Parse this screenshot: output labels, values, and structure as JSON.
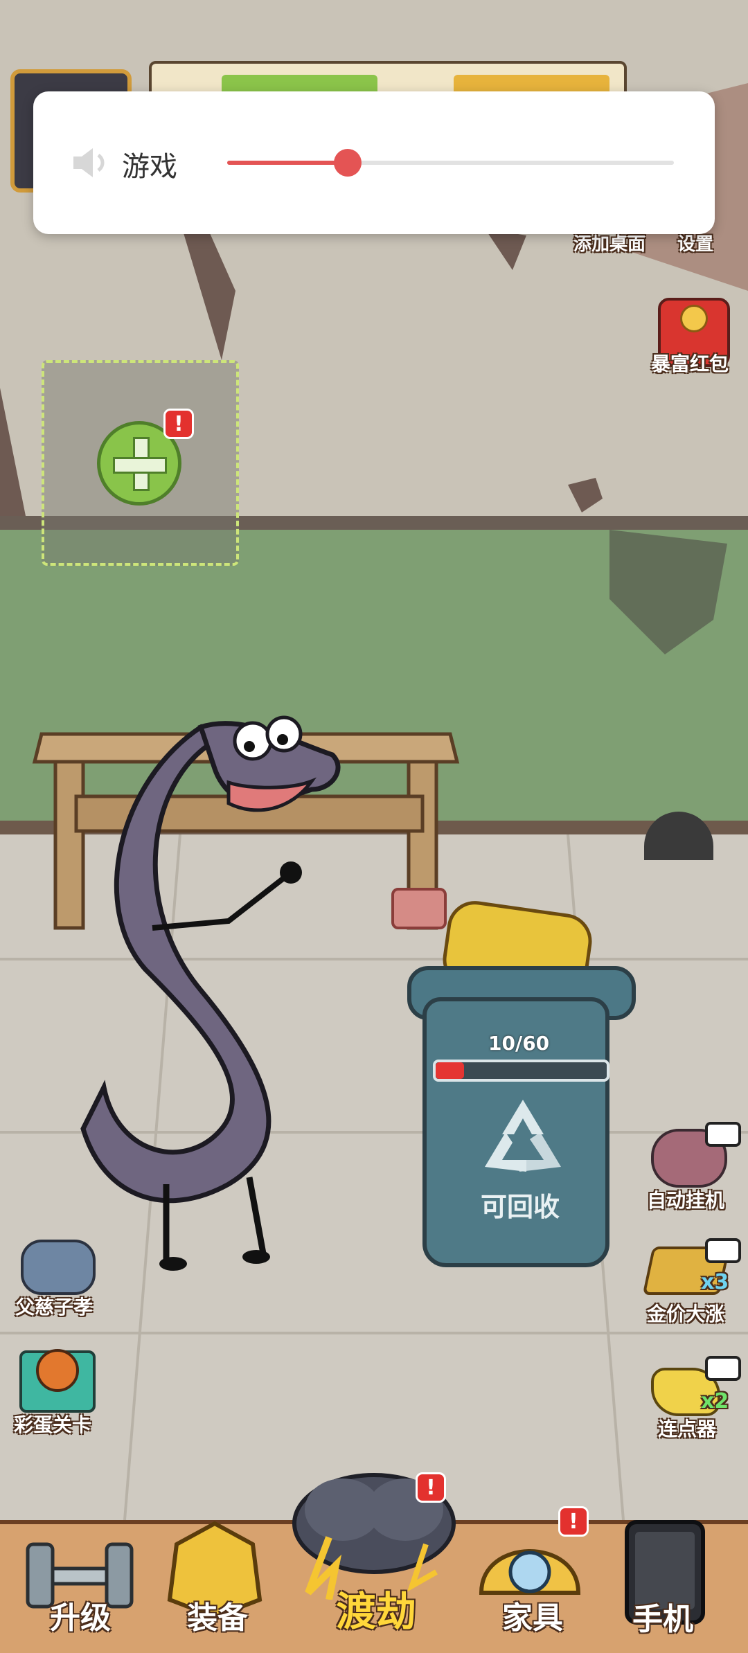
{
  "settings_dialog": {
    "icon": "speaker-icon",
    "label": "游戏",
    "volume": 0.27
  },
  "top_right_buttons": [
    {
      "label": "添加桌面",
      "icon": "desktop-add-icon"
    },
    {
      "label": "设置",
      "icon": "gear-icon"
    }
  ],
  "red_packet": {
    "label": "暴富红包",
    "icon": "red-packet-icon"
  },
  "add_furniture": {
    "icon": "plus-icon",
    "alert": "!"
  },
  "trash_bin": {
    "count_text": "10/60",
    "progress": 0.1667,
    "label": "可回收",
    "icon": "recycle-icon"
  },
  "right_buttons": [
    {
      "label": "自动挂机",
      "icon": "robot-icon",
      "badge": "video-icon"
    },
    {
      "label": "金价大涨",
      "icon": "gold-bars-icon",
      "badge": "video-icon",
      "multiplier": "x3"
    },
    {
      "label": "连点器",
      "icon": "clicker-icon",
      "badge": "video-icon",
      "multiplier": "x2"
    }
  ],
  "left_buttons": [
    {
      "label": "父慈子孝",
      "icon": "family-icon"
    },
    {
      "label": "彩蛋关卡",
      "icon": "basketball-gift-icon"
    }
  ],
  "bottom_nav": [
    {
      "label": "升级",
      "icon": "dumbbell-icon",
      "alert": ""
    },
    {
      "label": "装备",
      "icon": "gold-armor-icon",
      "alert": ""
    },
    {
      "label": "渡劫",
      "icon": "storm-cloud-icon",
      "alert": "!"
    },
    {
      "label": "家具",
      "icon": "shell-pearl-icon",
      "alert": "!"
    },
    {
      "label": "手机",
      "icon": "phone-icon",
      "alert": ""
    }
  ],
  "colors": {
    "accent_red": "#e45454",
    "alert_red": "#e3312e",
    "wall_green": "#7f9f73",
    "bin_blue": "#4f7a87"
  }
}
